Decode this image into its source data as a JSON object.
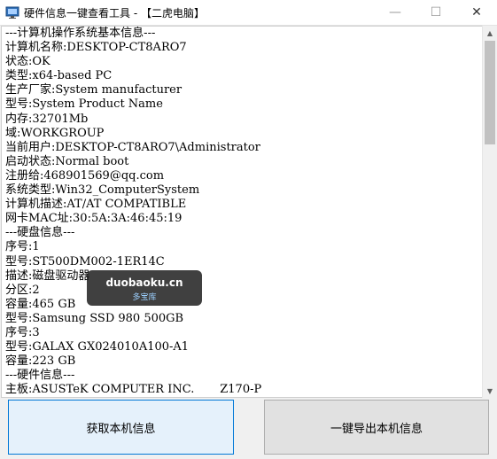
{
  "window": {
    "title": "硬件信息一键查看工具 - 【二虎电脑】",
    "controls": {
      "minimize": "—",
      "maximize": "☐",
      "close": "✕"
    }
  },
  "info_lines": [
    "---计算机操作系统基本信息---",
    "计算机名称:DESKTOP-CT8ARO7",
    "状态:OK",
    "类型:x64-based PC",
    "生产厂家:System manufacturer",
    "型号:System Product Name",
    "内存:32701Mb",
    "域:WORKGROUP",
    "当前用户:DESKTOP-CT8ARO7\\Administrator",
    "启动状态:Normal boot",
    "注册给:468901569@qq.com",
    "系统类型:Win32_ComputerSystem",
    "计算机描述:AT/AT COMPATIBLE",
    "网卡MAC址:30:5A:3A:46:45:19",
    "---硬盘信息---",
    "序号:1",
    "型号:ST500DM002-1ER14C",
    "描述:磁盘驱动器",
    "分区:2",
    "容量:465 GB",
    "型号:Samsung SSD 980 500GB",
    "序号:3",
    "型号:GALAX GX024010A100-A1",
    "容量:223 GB",
    "---硬件信息---",
    "主板:ASUSTeK COMPUTER INC.       Z170-P"
  ],
  "buttons": {
    "get_info": "获取本机信息",
    "export_info": "一键导出本机信息"
  },
  "watermark": {
    "site": "duobaoku.cn",
    "name": "多宝库"
  },
  "icons": {
    "app": "app-icon",
    "scroll_up": "chevron-up-icon",
    "scroll_down": "chevron-down-icon"
  },
  "colors": {
    "primary_button_bg": "#e5f1fb",
    "primary_button_border": "#0078d7",
    "button_bg": "#e1e1e1"
  }
}
